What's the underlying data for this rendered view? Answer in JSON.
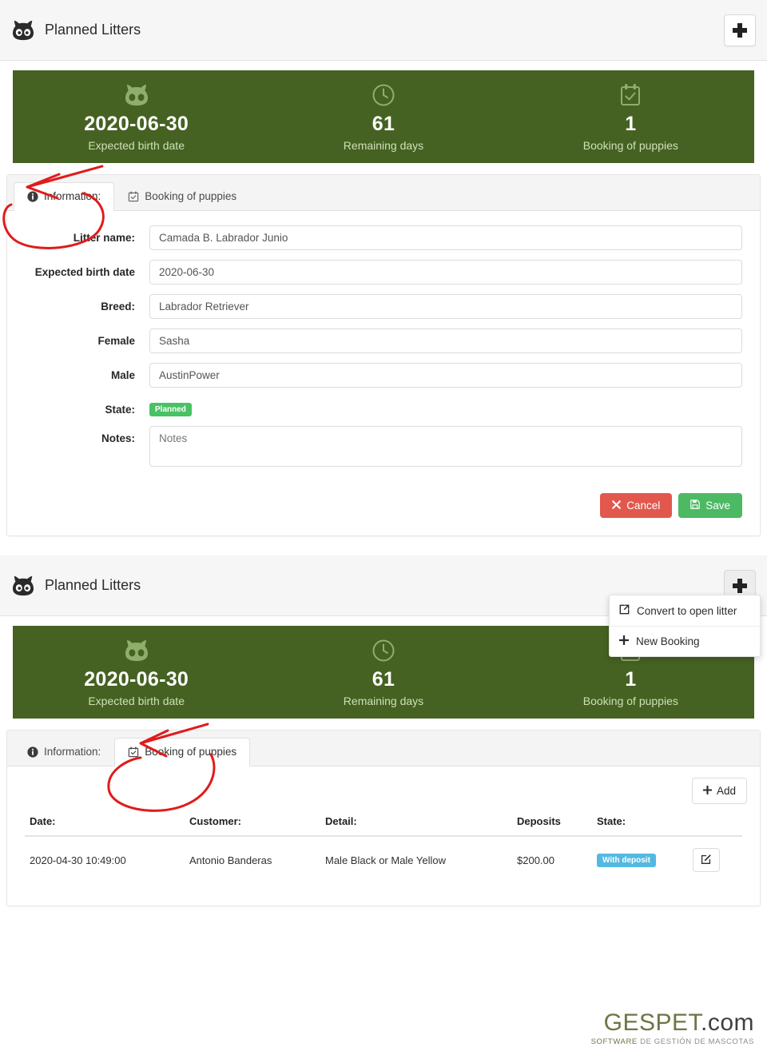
{
  "panel_one": {
    "header": {
      "title": "Planned Litters",
      "icon": "octocat-icon",
      "add_button_icon": "plus-icon"
    },
    "stats": [
      {
        "icon": "octocat-icon",
        "value": "2020-06-30",
        "label": "Expected birth date"
      },
      {
        "icon": "clock-icon",
        "value": "61",
        "label": "Remaining days"
      },
      {
        "icon": "calendar-check-icon",
        "value": "1",
        "label": "Booking of puppies"
      }
    ],
    "tabs": [
      {
        "label": "Information:",
        "icon": "info-circle-icon",
        "active": true
      },
      {
        "label": "Booking of puppies",
        "icon": "calendar-check-icon",
        "active": false
      }
    ],
    "form": {
      "fields": [
        {
          "label": "Litter name:",
          "value": "Camada B. Labrador Junio"
        },
        {
          "label": "Expected birth date",
          "value": "2020-06-30"
        },
        {
          "label": "Breed:",
          "value": "Labrador Retriever"
        },
        {
          "label": "Female",
          "value": "Sasha"
        },
        {
          "label": "Male",
          "value": "AustinPower"
        }
      ],
      "state_label": "State:",
      "state_badge": "Planned",
      "notes_label": "Notes:",
      "notes_value": "",
      "notes_placeholder": "Notes"
    },
    "buttons": {
      "cancel": {
        "label": "Cancel",
        "icon": "times-icon"
      },
      "save": {
        "label": "Save",
        "icon": "floppy-disk-icon"
      }
    }
  },
  "panel_two": {
    "header": {
      "title": "Planned Litters",
      "icon": "octocat-icon",
      "add_button_icon": "plus-icon"
    },
    "dropdown": {
      "items": [
        {
          "label": "Convert to open litter",
          "icon": "external-link-icon"
        },
        {
          "label": "New Booking",
          "icon": "plus-icon"
        }
      ]
    },
    "stats": [
      {
        "icon": "octocat-icon",
        "value": "2020-06-30",
        "label": "Expected birth date"
      },
      {
        "icon": "clock-icon",
        "value": "61",
        "label": "Remaining days"
      },
      {
        "icon": "calendar-check-icon",
        "value": "1",
        "label": "Booking of puppies"
      }
    ],
    "tabs": [
      {
        "label": "Information:",
        "icon": "info-circle-icon",
        "active": false
      },
      {
        "label": "Booking of puppies",
        "icon": "calendar-check-icon",
        "active": true
      }
    ],
    "add_button": {
      "label": "Add",
      "icon": "plus-icon"
    },
    "table": {
      "columns": [
        "Date:",
        "Customer:",
        "Detail:",
        "Deposits",
        "State:",
        ""
      ],
      "rows": [
        {
          "date": "2020-04-30 10:49:00",
          "customer": "Antonio Banderas",
          "detail": "Male Black or Male Yellow",
          "deposits": "$200.00",
          "state": "With deposit",
          "action_icon": "edit-icon"
        }
      ]
    }
  },
  "footer": {
    "brand": "GESPET",
    "brand_suffix": ".com",
    "tagline_strong": "SOFTWARE",
    "tagline_rest": " DE GESTIÓN DE MASCOTAS"
  },
  "colors": {
    "stats_green": "#456222",
    "badge_planned": "#48c264",
    "badge_deposit": "#53b9e2",
    "cancel_red": "#e2584d",
    "save_green": "#4cb963",
    "annotation_red": "#e01b1b"
  },
  "annotations": [
    {
      "name": "circle-information-tab",
      "color": "#e01b1b"
    },
    {
      "name": "circle-booking-tab",
      "color": "#e01b1b"
    }
  ]
}
